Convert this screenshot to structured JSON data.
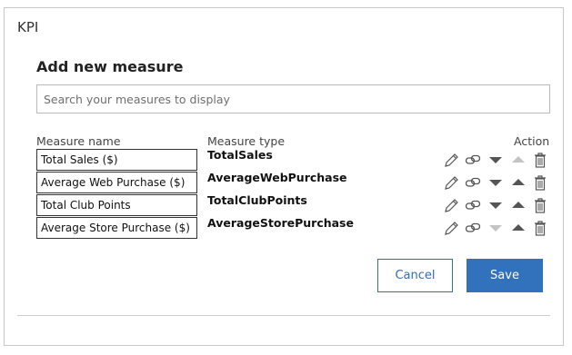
{
  "panel": {
    "title": "KPI",
    "heading": "Add new measure"
  },
  "search": {
    "placeholder": "Search your measures to display"
  },
  "columns": {
    "name": "Measure name",
    "type": "Measure type",
    "action": "Action"
  },
  "rows": [
    {
      "name": "Total Sales ($)",
      "type": "TotalSales",
      "move_down_enabled": true,
      "move_up_enabled": false
    },
    {
      "name": "Average Web Purchase ($)",
      "type": "AverageWebPurchase",
      "move_down_enabled": true,
      "move_up_enabled": true
    },
    {
      "name": "Total Club Points",
      "type": "TotalClubPoints",
      "move_down_enabled": true,
      "move_up_enabled": true
    },
    {
      "name": "Average Store Purchase ($)",
      "type": "AverageStorePurchase",
      "move_down_enabled": false,
      "move_up_enabled": true
    }
  ],
  "action_icons": [
    "edit-icon",
    "link-icon",
    "move-down-icon",
    "move-up-icon",
    "delete-icon"
  ],
  "buttons": {
    "cancel": "Cancel",
    "save": "Save"
  },
  "colors": {
    "accent": "#3272bd",
    "enabled_icon": "#555555",
    "disabled_icon": "#c4c4c4"
  }
}
